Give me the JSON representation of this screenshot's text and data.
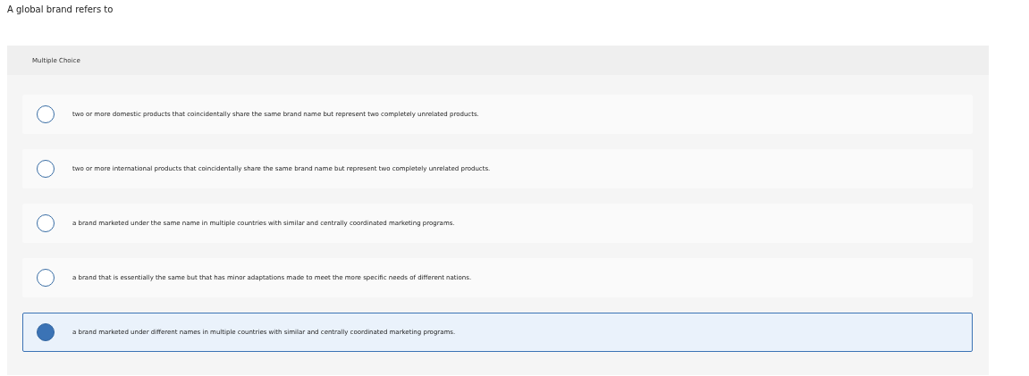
{
  "question": "A global brand refers to",
  "question_type": "Multiple Choice",
  "options": [
    {
      "text": "two or more domestic products that coincidentally share the same brand name but represent two completely unrelated products.",
      "selected": false
    },
    {
      "text": "two or more international products that coincidentally share the same brand name but represent two completely unrelated products.",
      "selected": false
    },
    {
      "text": "a brand marketed under the same name in multiple countries with similar and centrally coordinated marketing programs.",
      "selected": false
    },
    {
      "text": "a brand that is essentially the same but that has minor adaptations made to meet the more specific needs of different nations.",
      "selected": false
    },
    {
      "text": "a brand marketed under different names in multiple countries with similar and centrally coordinated marketing programs.",
      "selected": true
    }
  ]
}
